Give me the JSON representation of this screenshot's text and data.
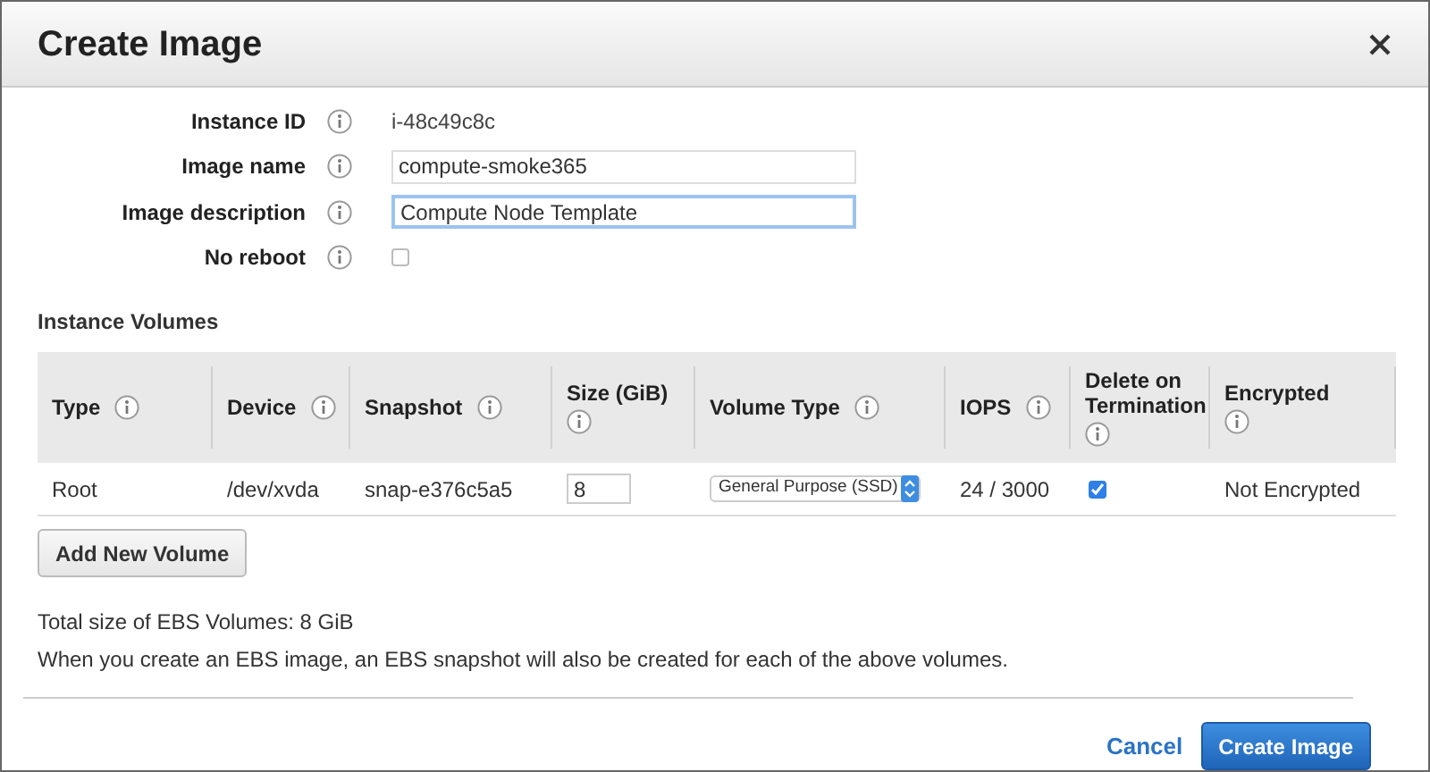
{
  "dialog": {
    "title": "Create Image"
  },
  "fields": [
    {
      "label": "Instance ID",
      "kind": "text",
      "value": "i-48c49c8c"
    },
    {
      "label": "Image name",
      "kind": "input",
      "value": "compute-smoke365",
      "focused": false
    },
    {
      "label": "Image description",
      "kind": "input",
      "value": "Compute Node Template",
      "focused": true
    },
    {
      "label": "No reboot",
      "kind": "checkbox",
      "checked": false
    }
  ],
  "volumes": {
    "title": "Instance Volumes",
    "columns": [
      {
        "label": "Type"
      },
      {
        "label": "Device"
      },
      {
        "label": "Snapshot"
      },
      {
        "label": "Size (GiB)"
      },
      {
        "label": "Volume Type"
      },
      {
        "label": "IOPS"
      },
      {
        "label": "Delete on Termination"
      },
      {
        "label": "Encrypted"
      }
    ],
    "rows": [
      [
        {
          "kind": "text",
          "value": "Root"
        },
        {
          "kind": "text",
          "value": "/dev/xvda"
        },
        {
          "kind": "text",
          "value": "snap-e376c5a5"
        },
        {
          "kind": "input",
          "value": "8"
        },
        {
          "kind": "select",
          "value": "General Purpose (SSD)"
        },
        {
          "kind": "text",
          "value": "24 / 3000"
        },
        {
          "kind": "checkbox",
          "checked": true
        },
        {
          "kind": "text",
          "value": "Not Encrypted"
        }
      ]
    ],
    "add_button": "Add New Volume"
  },
  "notes": [
    "Total size of EBS Volumes: 8 GiB",
    "When you create an EBS image, an EBS snapshot will also be created for each of the above volumes."
  ],
  "footer": {
    "cancel": "Cancel",
    "submit": "Create Image"
  }
}
